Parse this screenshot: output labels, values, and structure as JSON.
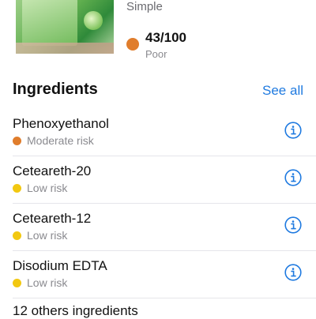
{
  "product": {
    "brand": "Simple",
    "score": "43/100",
    "rating": "Poor",
    "score_color": "#e07d2c"
  },
  "ingredients": {
    "title": "Ingredients",
    "see_all": "See all",
    "items": [
      {
        "name": "Phenoxyethanol",
        "risk": "Moderate risk",
        "risk_color": "#e07d2c",
        "icon": "info-icon"
      },
      {
        "name": "Ceteareth-20",
        "risk": "Low risk",
        "risk_color": "#f2c811",
        "icon": "info-icon"
      },
      {
        "name": "Ceteareth-12",
        "risk": "Low risk",
        "risk_color": "#f2c811",
        "icon": "info-icon"
      },
      {
        "name": "Disodium EDTA",
        "risk": "Low risk",
        "risk_color": "#f2c811",
        "icon": "info-icon"
      }
    ],
    "others_label": "12 others ingredients"
  },
  "accent_color": "#1f7ae0"
}
